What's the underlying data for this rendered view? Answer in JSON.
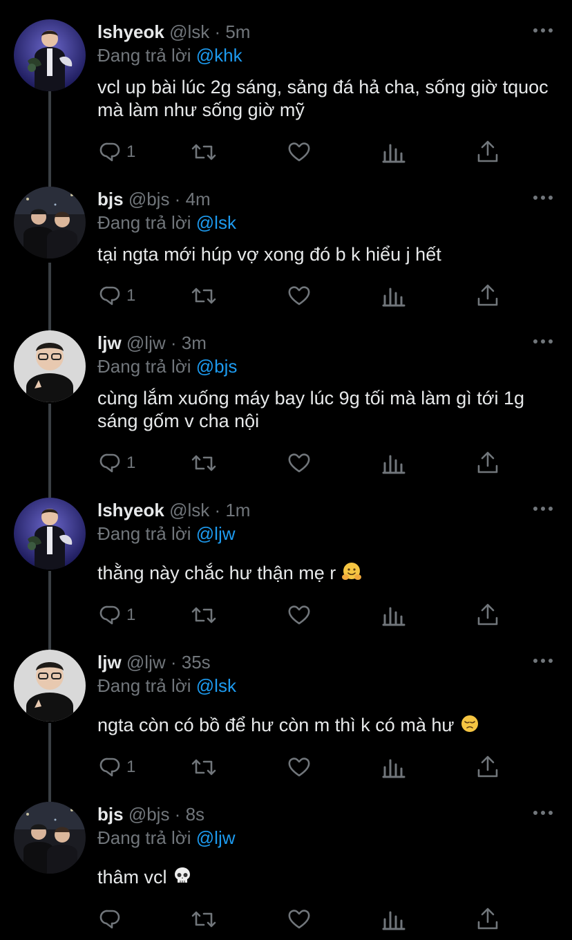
{
  "tweets": [
    {
      "name": "lshyeok",
      "handle": "@lsk",
      "time": "5m",
      "replying_prefix": "Đang trả lời ",
      "replying_to": "@khk",
      "text": "vcl up bài lúc 2g sáng, sảng đá hả cha, sống giờ tquoc mà làm như sống giờ mỹ",
      "emoji": "",
      "reply_count": "1",
      "avatar": "lshyeok-photo"
    },
    {
      "name": "bjs",
      "handle": "@bjs",
      "time": "4m",
      "replying_prefix": "Đang trả lời ",
      "replying_to": "@lsk",
      "text": "tại ngta mới húp vợ xong đó b k hiểu j hết",
      "emoji": "",
      "reply_count": "1",
      "avatar": "bjs-photo"
    },
    {
      "name": "ljw",
      "handle": "@ljw",
      "time": "3m",
      "replying_prefix": "Đang trả lời ",
      "replying_to": "@bjs",
      "text": "cùng lắm xuống máy bay lúc 9g tối mà làm gì tới 1g sáng gốm v cha nội",
      "emoji": "",
      "reply_count": "1",
      "avatar": "ljw-photo"
    },
    {
      "name": "lshyeok",
      "handle": "@lsk",
      "time": "1m",
      "replying_prefix": "Đang trả lời ",
      "replying_to": "@ljw",
      "text": "thằng này chắc hư thận mẹ r",
      "emoji": "hugging-face-emoji",
      "reply_count": "1",
      "avatar": "lshyeok-photo"
    },
    {
      "name": "ljw",
      "handle": "@ljw",
      "time": "35s",
      "replying_prefix": "Đang trả lời ",
      "replying_to": "@lsk",
      "text": "ngta còn có bồ để hư còn m thì k có mà hư",
      "emoji": "pensive-face-emoji",
      "reply_count": "1",
      "avatar": "ljw-photo"
    },
    {
      "name": "bjs",
      "handle": "@bjs",
      "time": "8s",
      "replying_prefix": "Đang trả lời ",
      "replying_to": "@ljw",
      "text": "thâm vcl",
      "emoji": "skull-emoji",
      "reply_count": "",
      "avatar": "bjs-photo"
    }
  ],
  "separator": " · ",
  "colors": {
    "background": "#000000",
    "text": "#e7e9ea",
    "secondary": "#71767b",
    "accent": "#1d9bf0",
    "thread_line": "#3a3f44"
  },
  "icons": [
    "more-icon",
    "reply-icon",
    "retweet-icon",
    "like-icon",
    "analytics-icon",
    "share-icon"
  ]
}
